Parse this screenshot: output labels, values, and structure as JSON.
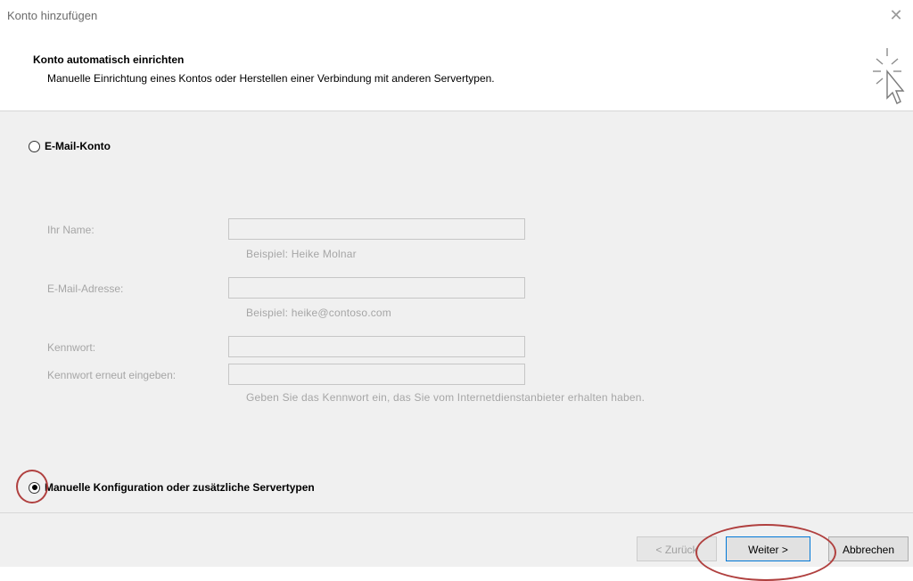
{
  "window": {
    "title": "Konto hinzufügen",
    "close_glyph": "✕"
  },
  "header": {
    "title": "Konto automatisch einrichten",
    "subtitle": "Manuelle Einrichtung eines Kontos oder Herstellen einer Verbindung mit anderen Servertypen.",
    "icon": "wizard-cursor-icon"
  },
  "options": {
    "email_account": {
      "label": "E-Mail-Konto",
      "selected": false
    },
    "manual_config": {
      "label": "Manuelle Konfiguration oder zusätzliche Servertypen",
      "selected": true
    }
  },
  "form": {
    "name": {
      "label": "Ihr Name:",
      "value": "",
      "hint": "Beispiel: Heike Molnar"
    },
    "email": {
      "label": "E-Mail-Adresse:",
      "value": "",
      "hint": "Beispiel: heike@contoso.com"
    },
    "password": {
      "label": "Kennwort:",
      "value": ""
    },
    "password_repeat": {
      "label": "Kennwort erneut eingeben:",
      "value": ""
    },
    "password_hint": "Geben Sie das Kennwort ein, das Sie vom Internetdienstanbieter erhalten haben."
  },
  "buttons": {
    "back": "< Zurück",
    "next": "Weiter >",
    "cancel": "Abbrechen"
  },
  "colors": {
    "annotation": "#b0403f",
    "dialog_bg": "#f0f0f0",
    "disabled_text": "#a6a6a6"
  }
}
